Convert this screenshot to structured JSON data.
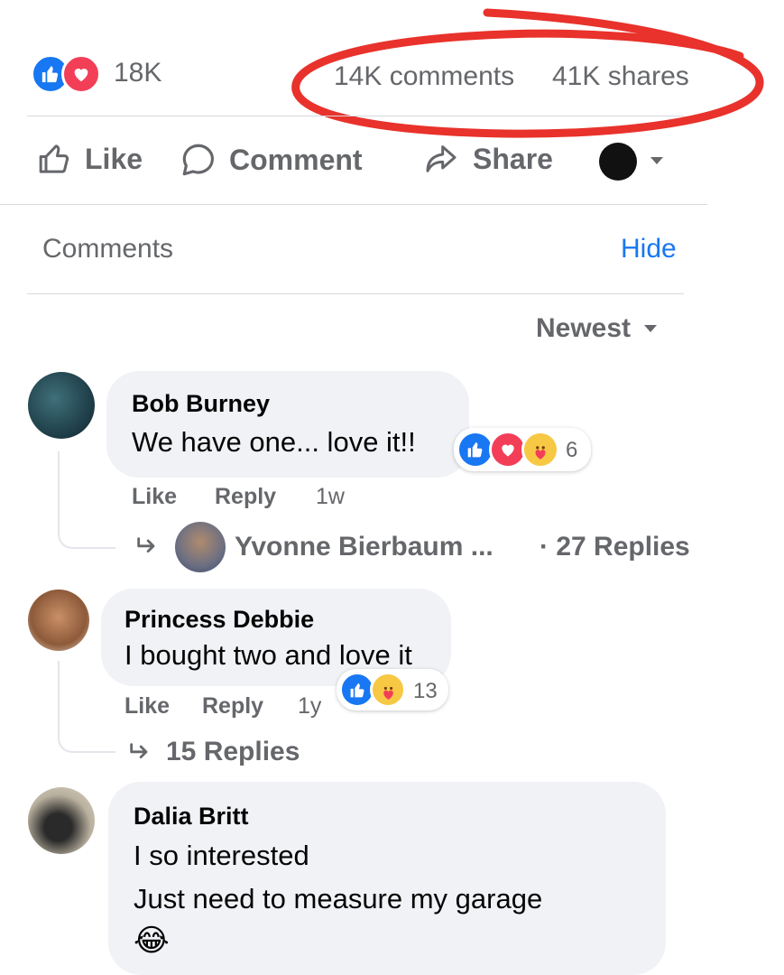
{
  "summary": {
    "reaction_icons": [
      "like-icon",
      "love-icon"
    ],
    "reactions_count": "18K",
    "comments_count": "14K comments",
    "shares_count": "41K shares"
  },
  "actions": {
    "like": "Like",
    "comment": "Comment",
    "share": "Share"
  },
  "comments_header": {
    "title": "Comments",
    "hide": "Hide",
    "sort": "Newest"
  },
  "comments": [
    {
      "author": "Bob Burney",
      "text": "We have one... love it!!",
      "reactions": [
        "like-icon",
        "love-icon",
        "care-icon"
      ],
      "reaction_count": "6",
      "like": "Like",
      "reply": "Reply",
      "time": "1w",
      "reply_preview": {
        "name": "Yvonne Bierbaum ...",
        "count": "· 27 Replies"
      }
    },
    {
      "author": "Princess Debbie",
      "text": "I bought two and love it",
      "reactions": [
        "like-icon",
        "care-icon"
      ],
      "reaction_count": "13",
      "like": "Like",
      "reply": "Reply",
      "time": "1y",
      "replies": "15 Replies"
    },
    {
      "author": "Dalia Britt",
      "text_line1": "I so interested",
      "text_line2": "Just need to measure my garage",
      "emoji": "😂"
    }
  ],
  "colors": {
    "annotation_red": "#e8322b",
    "link_blue": "#1877f2",
    "muted_gray": "#65676b",
    "bubble_gray": "#f0f2f5"
  }
}
